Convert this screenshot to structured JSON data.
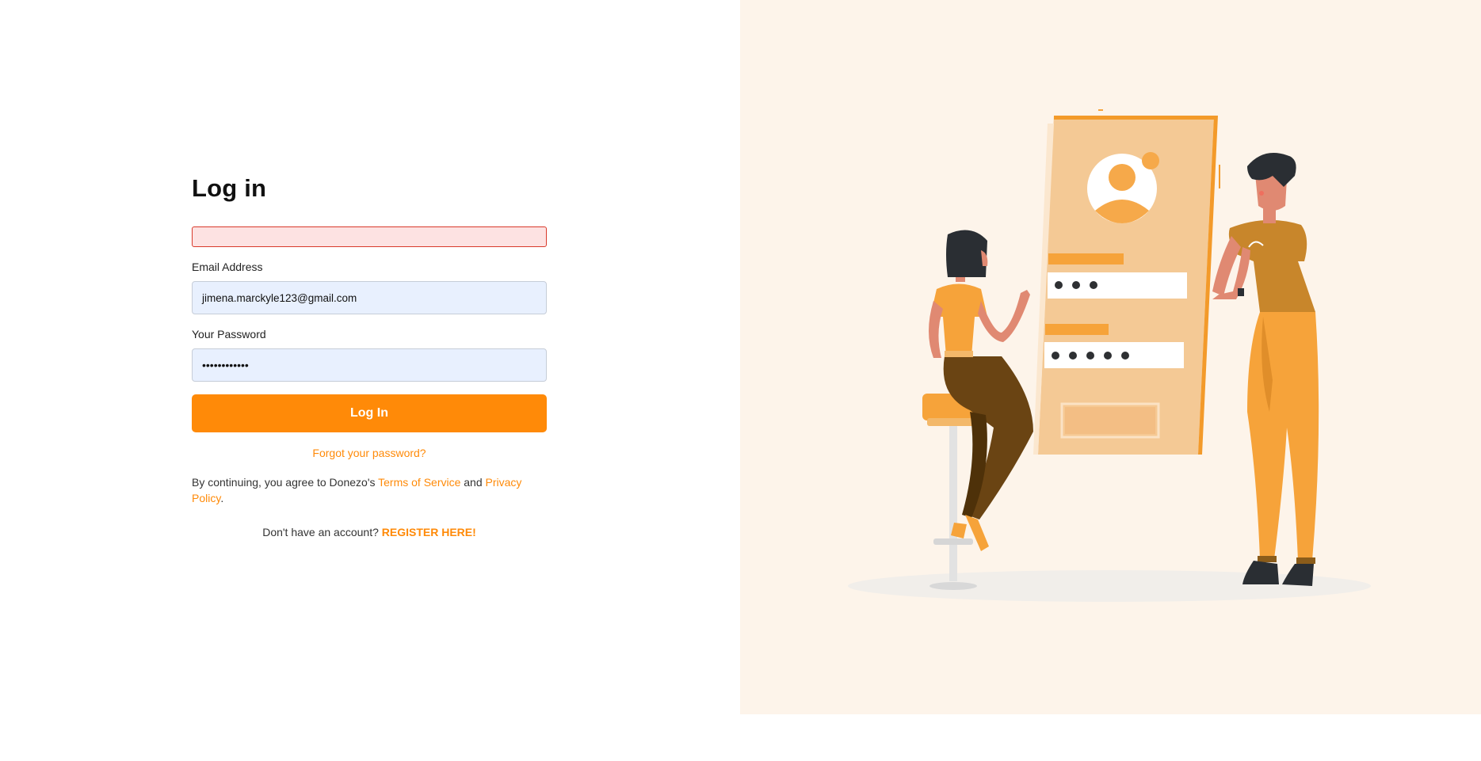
{
  "login": {
    "title": "Log in",
    "error_message": "",
    "email_label": "Email Address",
    "email_value": "jimena.marckyle123@gmail.com",
    "password_label": "Your Password",
    "password_value": "••••••••••••",
    "submit_label": "Log In",
    "forgot_link": "Forgot your password?",
    "terms_prefix": "By continuing, you agree to Donezo's ",
    "terms_link": "Terms of Service",
    "terms_and": " and ",
    "privacy_link": "Privacy Policy",
    "terms_suffix": ".",
    "register_prompt": "Don't have an account? ",
    "register_link": "REGISTER HERE!"
  },
  "theme": {
    "accent": "#ff8a08",
    "error_border": "#d93a2b",
    "error_bg": "#fde2e2",
    "input_bg": "#e8f0fe",
    "illustration_bg": "#fdf4ea"
  },
  "illustration": {
    "icons": [
      "user-avatar-icon",
      "password-dots-icon"
    ]
  }
}
